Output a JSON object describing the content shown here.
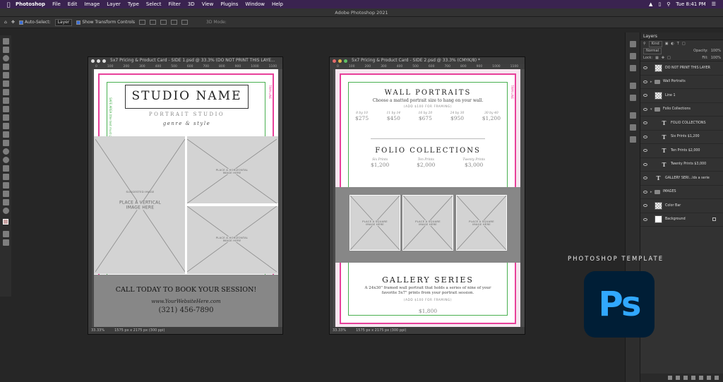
{
  "menubar": {
    "app": "Photoshop",
    "items": [
      "File",
      "Edit",
      "Image",
      "Layer",
      "Type",
      "Select",
      "Filter",
      "3D",
      "View",
      "Plugins",
      "Window",
      "Help"
    ],
    "clock": "Tue 8:41 PM"
  },
  "window_title": "Adobe Photoshop 2021",
  "options": {
    "auto_select_label": "Auto-Select:",
    "auto_select_value": "Layer",
    "transform_label": "Show Transform Controls",
    "mode_3d": "3D Mode:"
  },
  "doc1": {
    "title": "5x7 Pricing & Product Card - SIDE 1.psd @ 33.3% (DO NOT PRINT THIS LAYE...",
    "zoom": "33.33%",
    "size": "1575 px x 2175 px (300 ppi)",
    "studio_name": "STUDIO NAME",
    "subtitle": "PORTRAIT STUDIO",
    "tagline": "genre & style",
    "vertical_ph_small": "SUGGESTED IMAGE",
    "vertical_ph": "PLACE A VERTICAL\nIMAGE HERE",
    "horizontal_ph": "PLACE A HORIZONTAL\nIMAGE HERE",
    "cta": "CALL TODAY TO BOOK YOUR SESSION!",
    "website": "www.YourWebsiteHere.com",
    "phone": "(321) 456-7890",
    "bleed_label": "TRIM LINE",
    "safe_label": "SAFE AREA (the text must go past this line)"
  },
  "doc2": {
    "title": "5x7 Pricing & Product Card - SIDE 2.psd @ 33.3% (CMYK/8) *",
    "zoom": "33.33%",
    "size": "1575 px x 2175 px (300 ppi)",
    "wall_title": "WALL PORTRAITS",
    "wall_sub": "Choose a matted portrait size to hang on your wall.",
    "wall_note": "(ADD $100 FOR FRAMING)",
    "wall_sizes": [
      {
        "size": "8 by 10",
        "price": "$275"
      },
      {
        "size": "11 by 14",
        "price": "$450"
      },
      {
        "size": "16 by 20",
        "price": "$675"
      },
      {
        "size": "24 by 30",
        "price": "$950"
      },
      {
        "size": "30 by 40",
        "price": "$1,200"
      }
    ],
    "folio_title": "FOLIO COLLECTIONS",
    "folio_items": [
      {
        "name": "Six Prints",
        "price": "$1,200"
      },
      {
        "name": "Ten Prints",
        "price": "$2,000"
      },
      {
        "name": "Twenty Prints",
        "price": "$3,000"
      }
    ],
    "square_ph": "PLACE A SQUARE\nIMAGE HERE",
    "gallery_title": "GALLERY SERIES",
    "gallery_desc": "A 24x30\" framed wall portrait that holds a series of nine of your favorite 5x7\" prints from your portrait session.",
    "gallery_note": "(ADD $100 FOR FRAMING)",
    "gallery_price": "$1,800",
    "bleed_label": "TRIM LINE"
  },
  "layers_panel": {
    "tab": "Layers",
    "kind_label": "Kind",
    "mode_label": "Normal",
    "opacity_label": "Opacity:",
    "opacity_value": "100%",
    "lock_label": "Lock:",
    "fill_label": "Fill:",
    "fill_value": "100%",
    "layers": [
      {
        "name": "DO NOT PRINT THIS LAYER",
        "kind": "pixel",
        "indent": 0
      },
      {
        "name": "Wall Portraits",
        "kind": "group",
        "indent": 0
      },
      {
        "name": "Line 1",
        "kind": "pixel",
        "indent": 0
      },
      {
        "name": "Folio Collections",
        "kind": "group-open",
        "indent": 0
      },
      {
        "name": "FOLIO COLLECTIONS",
        "kind": "text",
        "indent": 1
      },
      {
        "name": "Six Prints $1,200",
        "kind": "text",
        "indent": 1
      },
      {
        "name": "Ten Prints $2,000",
        "kind": "text",
        "indent": 1
      },
      {
        "name": "Twenty Prints $3,000",
        "kind": "text",
        "indent": 1
      },
      {
        "name": "GALLERY SERI...lds a serie",
        "kind": "text",
        "indent": 0
      },
      {
        "name": "IMAGES",
        "kind": "group",
        "indent": 0
      },
      {
        "name": "Color Bar",
        "kind": "pixel",
        "indent": 0
      },
      {
        "name": "Background",
        "kind": "white",
        "indent": 0
      }
    ]
  },
  "promo": {
    "text": "PHOTOSHOP TEMPLATE",
    "logo": "Ps"
  }
}
